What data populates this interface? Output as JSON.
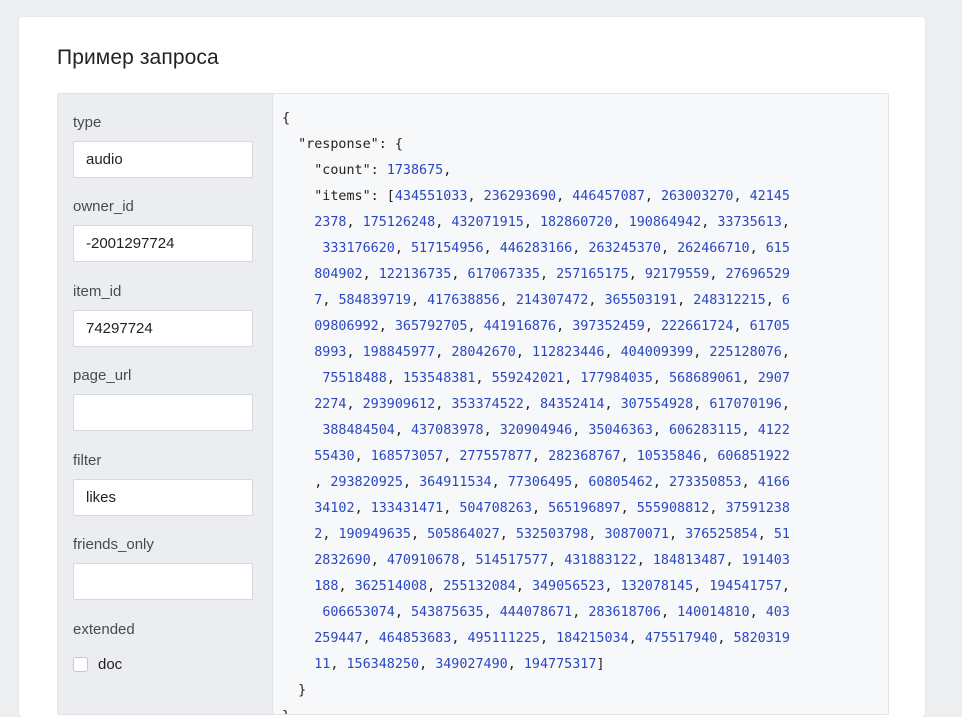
{
  "title": "Пример запроса",
  "params": [
    {
      "label": "type",
      "value": "audio"
    },
    {
      "label": "owner_id",
      "value": "-2001297724"
    },
    {
      "label": "item_id",
      "value": "74297724"
    },
    {
      "label": "page_url",
      "value": ""
    },
    {
      "label": "filter",
      "value": "likes"
    },
    {
      "label": "friends_only",
      "value": ""
    },
    {
      "label": "extended",
      "checkbox_label": "doc"
    }
  ],
  "response": {
    "count": 1738675,
    "items": [
      434551033,
      236293690,
      446457087,
      263003270,
      421452378,
      175126248,
      432071915,
      182860720,
      190864942,
      33735613,
      333176620,
      517154956,
      446283166,
      263245370,
      262466710,
      615804902,
      122136735,
      617067335,
      257165175,
      92179559,
      276965297,
      584839719,
      417638856,
      214307472,
      365503191,
      248312215,
      609806992,
      365792705,
      441916876,
      397352459,
      222661724,
      617058993,
      198845977,
      28042670,
      112823446,
      404009399,
      225128076,
      75518488,
      153548381,
      559242021,
      177984035,
      568689061,
      29072274,
      293909612,
      353374522,
      84352414,
      307554928,
      617070196,
      388484504,
      437083978,
      320904946,
      35046363,
      606283115,
      412255430,
      168573057,
      277557877,
      282368767,
      10535846,
      606851922,
      293820925,
      364911534,
      77306495,
      60805462,
      273350853,
      416634102,
      133431471,
      504708263,
      565196897,
      555908812,
      375912382,
      190949635,
      505864027,
      532503798,
      30870071,
      376525854,
      512832690,
      470910678,
      514517577,
      431883122,
      184813487,
      191403188,
      362514008,
      255132084,
      349056523,
      132078145,
      194541757,
      606653074,
      543875635,
      444078671,
      283618706,
      140014810,
      403259447,
      464853683,
      495111225,
      184215034,
      475517940,
      582031911,
      156348250,
      349027490,
      194775317
    ]
  }
}
